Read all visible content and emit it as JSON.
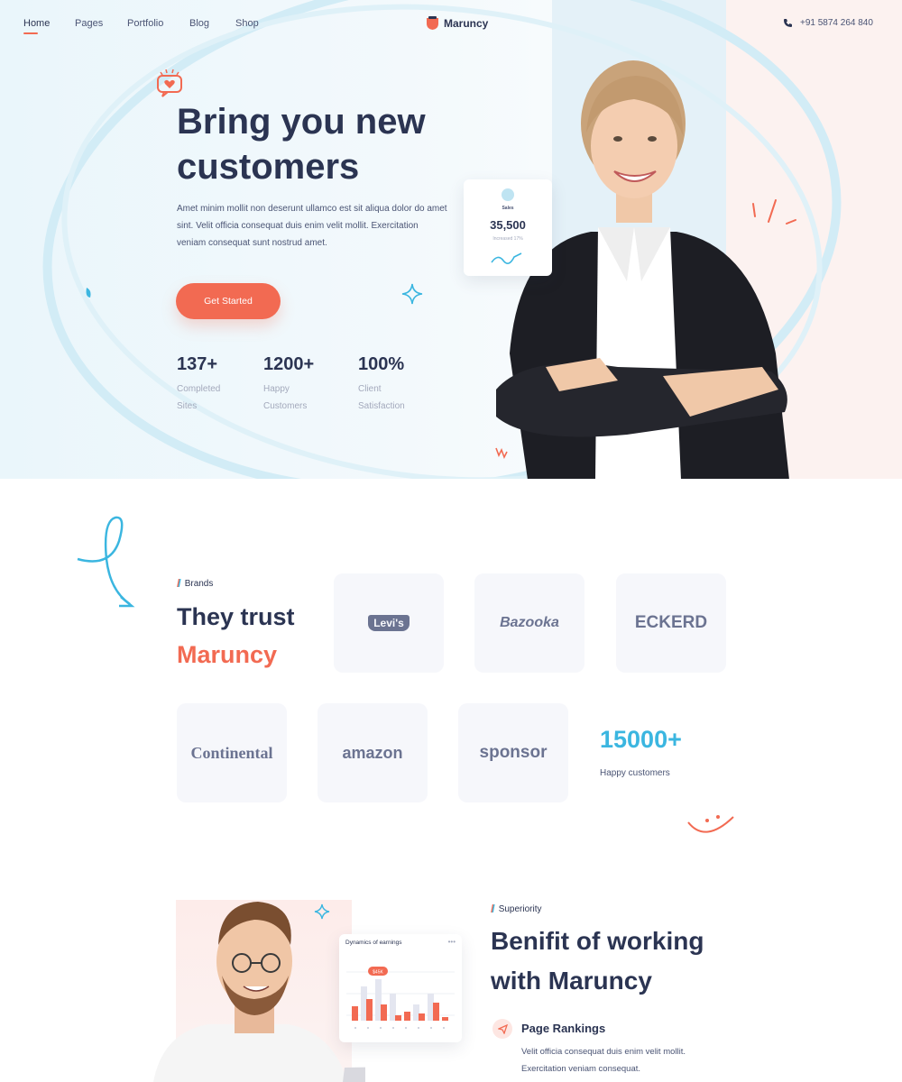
{
  "nav": {
    "items": [
      "Home",
      "Pages",
      "Portfolio",
      "Blog",
      "Shop"
    ],
    "brand": "Maruncy",
    "phone": "+91 5874 264 840"
  },
  "hero": {
    "title": "Bring you new customers",
    "text": "Amet minim mollit non deserunt ullamco est sit aliqua dolor do amet sint. Velit officia consequat duis enim velit mollit. Exercitation veniam consequat sunt nostrud amet.",
    "cta_label": "Get Started",
    "stats": [
      {
        "value": "137+",
        "label": "Completed Sites"
      },
      {
        "value": "1200+",
        "label": "Happy Customers"
      },
      {
        "value": "100%",
        "label": "Client Satisfaction"
      }
    ],
    "sales_card": {
      "label": "Sales",
      "value": "35,500",
      "sub": "Increased 17%"
    }
  },
  "brands": {
    "tag": "Brands",
    "title": "They trust",
    "accent": "Maruncy",
    "logos": [
      "Levi's",
      "Bazooka",
      "ECKERD",
      "Continental",
      "amazon",
      "sponsor"
    ],
    "count": "15000+",
    "count_label": "Happy customers"
  },
  "benefits": {
    "tag": "Superiority",
    "title": "Benifit of working with Maruncy",
    "card_title": "Dynamics of earnings",
    "card_badge": "$45K",
    "feature_title": "Page Rankings",
    "feature_text": "Velit officia consequat duis enim velit mollit. Exercitation veniam consequat."
  },
  "colors": {
    "accent": "#f26a52",
    "secondary": "#3bb6e0",
    "heading": "#2b3452"
  }
}
